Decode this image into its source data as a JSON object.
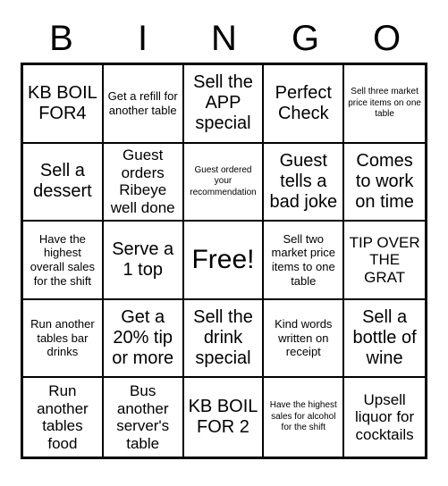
{
  "card": {
    "title": "Bingo Card",
    "background_color": "#ffffff",
    "border_color": "#000000",
    "header": {
      "letters": [
        "B",
        "I",
        "N",
        "G",
        "O"
      ]
    },
    "grid": {
      "columns": 5,
      "rows": 5,
      "free_space_index": 12,
      "cells": [
        {
          "text": "KB BOIL FOR4",
          "size": "lg"
        },
        {
          "text": "Get a refill for another table",
          "size": "sm"
        },
        {
          "text": "Sell the APP special",
          "size": "lg"
        },
        {
          "text": "Perfect Check",
          "size": "lg"
        },
        {
          "text": "Sell three market price items on one table",
          "size": "xs"
        },
        {
          "text": "Sell a dessert",
          "size": "lg"
        },
        {
          "text": "Guest orders Ribeye well done",
          "size": "md"
        },
        {
          "text": "Guest ordered your recommendation",
          "size": "xs"
        },
        {
          "text": "Guest tells a bad joke",
          "size": "lg"
        },
        {
          "text": "Comes to work on time",
          "size": "lg"
        },
        {
          "text": "Have the highest overall sales for the shift",
          "size": "sm"
        },
        {
          "text": "Serve a 1 top",
          "size": "lg"
        },
        {
          "text": "Free!",
          "size": "xl"
        },
        {
          "text": "Sell two market price items to one table",
          "size": "sm"
        },
        {
          "text": "TIP OVER THE GRAT",
          "size": "md"
        },
        {
          "text": "Run another tables bar drinks",
          "size": "sm"
        },
        {
          "text": "Get a 20% tip or more",
          "size": "lg"
        },
        {
          "text": "Sell the drink special",
          "size": "lg"
        },
        {
          "text": "Kind words written on receipt",
          "size": "sm"
        },
        {
          "text": "Sell a bottle of wine",
          "size": "lg"
        },
        {
          "text": "Run another tables food",
          "size": "md"
        },
        {
          "text": "Bus another server's table",
          "size": "md"
        },
        {
          "text": "KB BOIL FOR 2",
          "size": "lg"
        },
        {
          "text": "Have the highest sales for alcohol for the shift",
          "size": "xs"
        },
        {
          "text": "Upsell liquor for cocktails",
          "size": "md"
        }
      ]
    }
  }
}
